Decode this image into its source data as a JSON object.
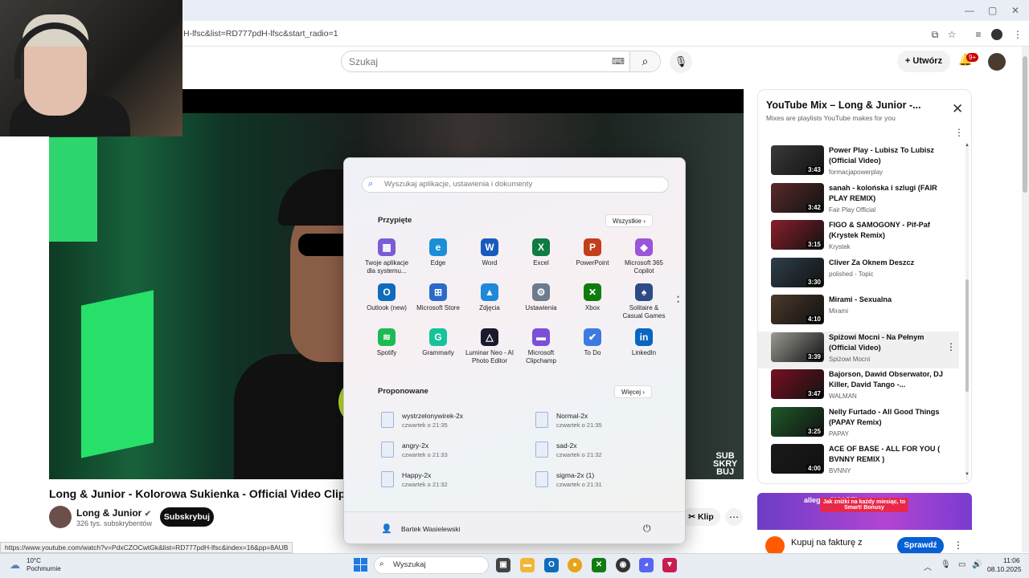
{
  "browser": {
    "url": "H-lfsc&list=RD777pdH-lfsc&start_radio=1",
    "status_url": "https://www.youtube.com/watch?v=PdxCZOCwtGk&list=RD777pdH-lfsc&index=16&pp=8AUB"
  },
  "youtube": {
    "search_placeholder": "Szukaj",
    "create_label": "Utwórz",
    "notif_count": "9+",
    "video": {
      "title": "Long & Junior - Kolorowa Sukienka - Official Video Clip",
      "channel": "Long & Junior",
      "subs": "326 tys. subskrybentów",
      "subscribe_label": "Subskrybuj",
      "clip_label": "Klip",
      "watermark": [
        "SUB",
        "SKRY",
        "BUJ"
      ]
    },
    "playlist": {
      "title": "YouTube Mix – Long & Junior -...",
      "subtitle": "Mixes are playlists YouTube makes for you",
      "items": [
        {
          "title": "Power Play - Lubisz To Lubisz (Official Video)",
          "channel": "formacjapowerplay",
          "duration": "3:43",
          "color": "#3a3a3a"
        },
        {
          "title": "sanah - kolońska i szlugi (FAIR PLAY REMIX)",
          "channel": "Fair Play Official",
          "duration": "3:42",
          "color": "#5a2a2a"
        },
        {
          "title": "FIGO & SAMOGONY - Pif-Paf (Krystek Remix)",
          "channel": "Krystek",
          "duration": "3:15",
          "color": "#8a1f2b"
        },
        {
          "title": "Cliver Za Oknem Deszcz",
          "channel": "polished - Topic",
          "duration": "3:30",
          "color": "#2f3f4a"
        },
        {
          "title": "Mirami - Sexualna",
          "channel": "Mirami",
          "duration": "4:10",
          "color": "#4a3a2a"
        },
        {
          "title": "Spiżowi Mocni - Na Pełnym (Official Video)",
          "channel": "Spiżowi Mocni",
          "duration": "3:39",
          "color": "#9a9a94"
        },
        {
          "title": "Bajorson, Dawid Obserwator, DJ Killer, David Tango -...",
          "channel": "WALMAN",
          "duration": "3:47",
          "color": "#7a1020"
        },
        {
          "title": "Nelly Furtado - All Good Things (PAPAY Remix)",
          "channel": "PAPAY",
          "duration": "3:25",
          "color": "#1f5a2a"
        },
        {
          "title": "ACE OF BASE - ALL FOR YOU ( BVNNY REMIX )",
          "channel": "BVNNY",
          "duration": "4:00",
          "color": "#1a1a1a"
        }
      ]
    },
    "ad": {
      "brand": "allegro SMART!",
      "headline": "Jak zniżki na każdy miesiąc, to Smart! Bonusy",
      "title": "Kupuj na fakturę z",
      "button": "Sprawdź"
    }
  },
  "start_menu": {
    "search_placeholder": "Wyszukaj aplikacje, ustawienia i dokumenty",
    "pinned_header": "Przypięte",
    "all_label": "Wszystkie",
    "pinned": [
      {
        "label": "Twoje aplikacje dla systemu...",
        "icon": "apps-icon",
        "color": "#7b5cd6",
        "glyph": "▦"
      },
      {
        "label": "Edge",
        "icon": "edge-icon",
        "color": "#1b8fd6",
        "glyph": "e"
      },
      {
        "label": "Word",
        "icon": "word-icon",
        "color": "#185abd",
        "glyph": "W"
      },
      {
        "label": "Excel",
        "icon": "excel-icon",
        "color": "#107c41",
        "glyph": "X"
      },
      {
        "label": "PowerPoint",
        "icon": "powerpoint-icon",
        "color": "#c43e1c",
        "glyph": "P"
      },
      {
        "label": "Microsoft 365 Copilot",
        "icon": "copilot-icon",
        "color": "#9a55d8",
        "glyph": "◆"
      },
      {
        "label": "Outlook (new)",
        "icon": "outlook-icon",
        "color": "#0f6cbd",
        "glyph": "O"
      },
      {
        "label": "Microsoft Store",
        "icon": "store-icon",
        "color": "#2a6ac9",
        "glyph": "⊞"
      },
      {
        "label": "Zdjęcia",
        "icon": "photos-icon",
        "color": "#1f88d8",
        "glyph": "▲"
      },
      {
        "label": "Ustawienia",
        "icon": "settings-icon",
        "color": "#6d7b8f",
        "glyph": "⚙"
      },
      {
        "label": "Xbox",
        "icon": "xbox-icon",
        "color": "#107c10",
        "glyph": "✕"
      },
      {
        "label": "Solitaire & Casual Games",
        "icon": "solitaire-icon",
        "color": "#2d4b86",
        "glyph": "♠"
      },
      {
        "label": "Spotify",
        "icon": "spotify-icon",
        "color": "#1db954",
        "glyph": "≋"
      },
      {
        "label": "Grammarly",
        "icon": "grammarly-icon",
        "color": "#15c39a",
        "glyph": "G"
      },
      {
        "label": "Luminar Neo - AI Photo Editor",
        "icon": "luminar-icon",
        "color": "#1a1a2e",
        "glyph": "△"
      },
      {
        "label": "Microsoft Clipchamp",
        "icon": "clipchamp-icon",
        "color": "#7b4fd8",
        "glyph": "▬"
      },
      {
        "label": "To Do",
        "icon": "todo-icon",
        "color": "#3d7ae0",
        "glyph": "✔"
      },
      {
        "label": "LinkedIn",
        "icon": "linkedin-icon",
        "color": "#0a66c2",
        "glyph": "in"
      }
    ],
    "recommended_header": "Proponowane",
    "more_label": "Więcej",
    "recommended": [
      {
        "name": "wystrzelonywirek-2x",
        "time": "czwartek o 21:35"
      },
      {
        "name": "Normal-2x",
        "time": "czwartek o 21:35"
      },
      {
        "name": "angry-2x",
        "time": "czwartek o 21:33"
      },
      {
        "name": "sad-2x",
        "time": "czwartek o 21:32"
      },
      {
        "name": "Happy-2x",
        "time": "czwartek o 21:32"
      },
      {
        "name": "sigma-2x (1)",
        "time": "czwartek o 21:31"
      }
    ],
    "user": "Bartek Wasielewski"
  },
  "taskbar": {
    "temp": "10°C",
    "weather": "Pochmurnie",
    "search": "Wyszukaj",
    "time": "11:06",
    "date": "08.10.2025"
  }
}
